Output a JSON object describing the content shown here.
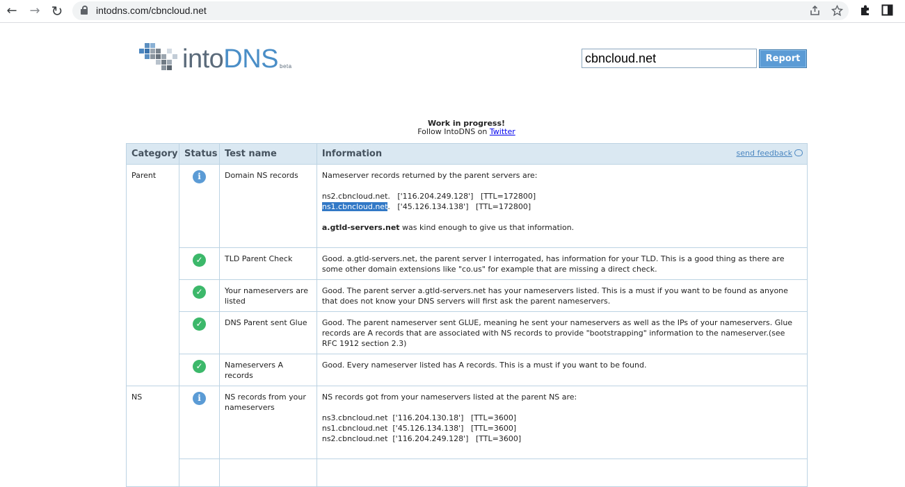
{
  "browser": {
    "url": "intodns.com/cbncloud.net",
    "back_glyph": "←",
    "forward_glyph": "→",
    "reload_glyph": "↻"
  },
  "logo": {
    "word_into": "into",
    "word_dns": "DNS",
    "beta": "beta"
  },
  "search": {
    "value": "cbncloud.net",
    "button": "Report"
  },
  "notice": {
    "title": "Work in progress!",
    "text": "Follow IntoDNS on ",
    "link": "Twitter"
  },
  "table": {
    "headers": {
      "category": "Category",
      "status": "Status",
      "test": "Test name",
      "info": "Information"
    },
    "feedback": "send feedback",
    "parent": {
      "category": "Parent",
      "rows": [
        {
          "status": "info",
          "test": "Domain NS records",
          "lines": [
            "Nameserver records returned by the parent servers are:",
            "",
            "ns2.cbncloud.net.   ['116.204.249.128']   [TTL=172800]"
          ],
          "selected_line": {
            "highlight": "ns1.cbncloud.net",
            "rest": ".   ['45.126.134.138']   [TTL=172800]"
          },
          "footer_bold": "a.gtld-servers.net",
          "footer_rest": " was kind enough to give us that information."
        },
        {
          "status": "ok",
          "test": "TLD Parent Check",
          "info": "Good. a.gtld-servers.net, the parent server I interrogated, has information for your TLD. This is a good thing as there are some other domain extensions like \"co.us\" for example that are missing a direct check."
        },
        {
          "status": "ok",
          "test": "Your nameservers are listed",
          "info": "Good. The parent server a.gtld-servers.net has your nameservers listed. This is a must if you want to be found as anyone that does not know your DNS servers will first ask the parent nameservers."
        },
        {
          "status": "ok",
          "test": "DNS Parent sent Glue",
          "info": "Good. The parent nameserver sent GLUE, meaning he sent your nameservers as well as the IPs of your nameservers. Glue records are A records that are associated with NS records to provide \"bootstrapping\" information to the nameserver.(see RFC 1912 section 2.3)"
        },
        {
          "status": "ok",
          "test": "Nameservers A records",
          "info": "Good. Every nameserver listed has A records. This is a must if you want to be found."
        }
      ]
    },
    "ns": {
      "category": "NS",
      "rows": [
        {
          "status": "info",
          "test": "NS records from your nameservers",
          "intro": "NS records got from your nameservers listed at the parent NS are:",
          "records": [
            "ns3.cbncloud.net  ['116.204.130.18']   [TTL=3600]",
            "ns1.cbncloud.net  ['45.126.134.138']   [TTL=3600]",
            "ns2.cbncloud.net  ['116.204.249.128']   [TTL=3600]"
          ]
        }
      ]
    },
    "status_glyphs": {
      "info": "i",
      "ok": "✓"
    }
  }
}
